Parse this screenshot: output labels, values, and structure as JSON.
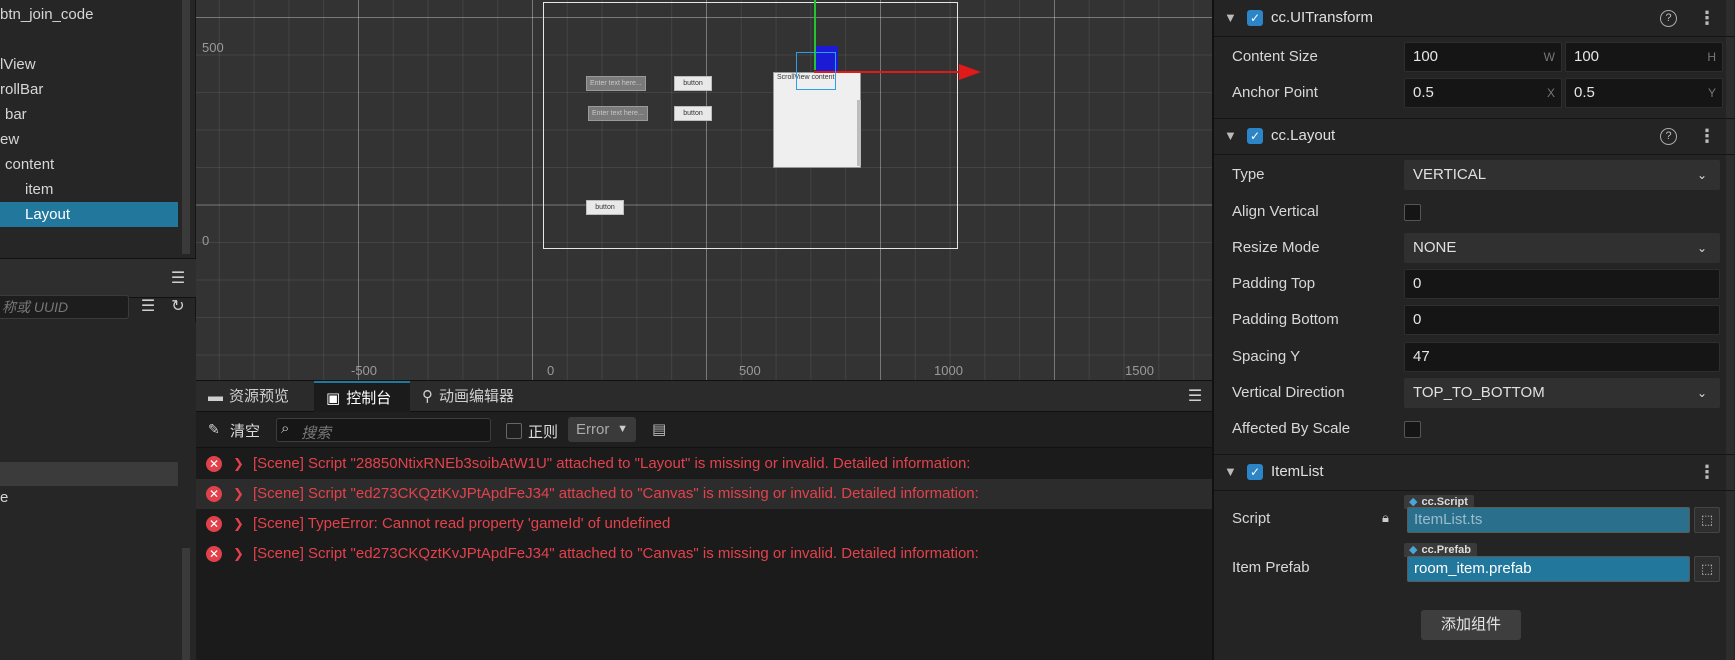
{
  "hierarchy": {
    "items": [
      {
        "label": "btn_join_code"
      },
      {
        "label": "lView"
      },
      {
        "label": "rollBar"
      },
      {
        "label": "bar"
      },
      {
        "label": "ew"
      },
      {
        "label": "content"
      },
      {
        "label": "item"
      },
      {
        "label": "Layout"
      }
    ]
  },
  "assets": {
    "search_placeholder": "称或 UUID",
    "row_label": "e"
  },
  "scene": {
    "axis": {
      "y_500": "500",
      "y_0": "0",
      "x_m500": "-500",
      "x_0": "0",
      "x_500": "500",
      "x_1000": "1000",
      "x_1500": "1500"
    },
    "widgets": {
      "input1": "Enter text here...",
      "input2": "Enter text here...",
      "button1": "button",
      "button2": "button",
      "button3": "button",
      "scrollview_label": "ScrollView content"
    }
  },
  "console": {
    "tabs": [
      {
        "label": "资源预览",
        "icon": "folder-icon"
      },
      {
        "label": "控制台",
        "icon": "terminal-icon"
      },
      {
        "label": "动画编辑器",
        "icon": "run-icon"
      }
    ],
    "clear_label": "清空",
    "search_placeholder": "搜索",
    "regex_label": "正则",
    "level_value": "Error",
    "logs": [
      {
        "text": "[Scene] Script \"28850NtixRNEb3soibAtW1U\" attached to \"Layout\" is missing or invalid. Detailed information:"
      },
      {
        "text": "[Scene] Script \"ed273CKQztKvJPtApdFeJ34\" attached to \"Canvas\" is missing or invalid. Detailed information:"
      },
      {
        "text": "[Scene] TypeError: Cannot read property 'gameId' of undefined"
      },
      {
        "text": "[Scene] Script \"ed273CKQztKvJPtApdFeJ34\" attached to \"Canvas\" is missing or invalid. Detailed information:"
      }
    ]
  },
  "inspector": {
    "uitransform": {
      "title": "cc.UITransform",
      "content_size_label": "Content Size",
      "width": "100",
      "height": "100",
      "w_suffix": "W",
      "h_suffix": "H",
      "anchor_label": "Anchor Point",
      "anchor_x": "0.5",
      "anchor_y": "0.5",
      "x_suffix": "X",
      "y_suffix": "Y"
    },
    "layout": {
      "title": "cc.Layout",
      "type_label": "Type",
      "type_value": "VERTICAL",
      "align_vertical_label": "Align Vertical",
      "resize_mode_label": "Resize Mode",
      "resize_mode_value": "NONE",
      "padding_top_label": "Padding Top",
      "padding_top_value": "0",
      "padding_bottom_label": "Padding Bottom",
      "padding_bottom_value": "0",
      "spacing_y_label": "Spacing Y",
      "spacing_y_value": "47",
      "vertical_direction_label": "Vertical Direction",
      "vertical_direction_value": "TOP_TO_BOTTOM",
      "affected_by_scale_label": "Affected By Scale"
    },
    "itemlist": {
      "title": "ItemList",
      "script_label": "Script",
      "script_tag": "cc.Script",
      "script_value": "ItemList.ts",
      "prefab_label": "Item Prefab",
      "prefab_tag": "cc.Prefab",
      "prefab_value": "room_item.prefab"
    },
    "add_component_label": "添加组件"
  },
  "colors": {
    "accent": "#22789c",
    "error": "#e3424c",
    "checkbox": "#2b85c7"
  }
}
